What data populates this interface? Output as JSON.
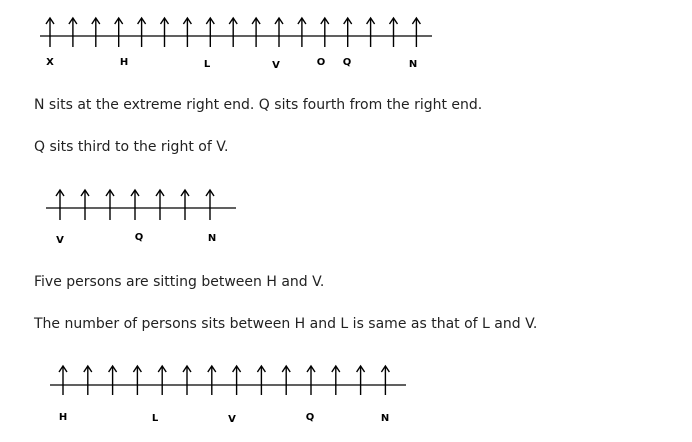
{
  "colors": {
    "text": "#222222",
    "lines": "#000000",
    "background": "#ffffff"
  },
  "diagrams": [
    {
      "id": "d1",
      "arrow_count": 17,
      "labels": [
        "X",
        "H",
        "L",
        "V",
        "O",
        "Q",
        "N"
      ]
    },
    {
      "id": "d2",
      "arrow_count": 7,
      "labels": [
        "V",
        "Q",
        "N"
      ]
    },
    {
      "id": "d3",
      "arrow_count": 14,
      "labels": [
        "H",
        "L",
        "V",
        "Q",
        "N"
      ]
    }
  ],
  "statements": [
    "N sits at the extreme right end. Q sits fourth from the right end.",
    "Q sits third to the right of V.",
    "Five persons are sitting between H and V.",
    "The number of persons sits between H and L is same as that of L and V."
  ],
  "icons": [
    "up-arrow-icon"
  ]
}
